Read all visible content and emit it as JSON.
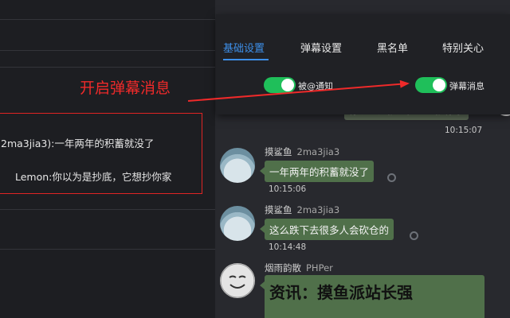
{
  "danmaku": {
    "line1": "2ma3jia3):一年两年的积蓄就没了",
    "line2": "Lemon:你以为是抄底，它想抄你家"
  },
  "annotation": "开启弹幕消息",
  "settings": {
    "tabs": [
      {
        "label": "基础设置",
        "active": true
      },
      {
        "label": "弹幕设置",
        "active": false
      },
      {
        "label": "黑名单",
        "active": false
      },
      {
        "label": "特别关心",
        "active": false
      }
    ],
    "toggles": [
      {
        "label": "被@通知",
        "on": true
      },
      {
        "label": "弹幕消息",
        "on": true
      }
    ]
  },
  "chat": {
    "partial_message": {
      "text": "你以为是抄底，它想抄你家",
      "time": "10:15:07"
    },
    "messages": [
      {
        "name": "摸鲨鱼",
        "uid": "2ma3jia3",
        "text": "一年两年的积蓄就没了",
        "time": "10:15:06"
      },
      {
        "name": "摸鲨鱼",
        "uid": "2ma3jia3",
        "text": "这么跌下去很多人会砍仓的",
        "time": "10:14:48"
      },
      {
        "name": "烟雨韵散",
        "uid": "PHPer",
        "text": "资讯：摸鱼派站长强",
        "time": ""
      }
    ]
  },
  "colors": {
    "accent": "#3d8fe8",
    "toggle_on": "#1fbf5a",
    "annotation": "#ef2a2a",
    "bubble": "#50704a"
  }
}
